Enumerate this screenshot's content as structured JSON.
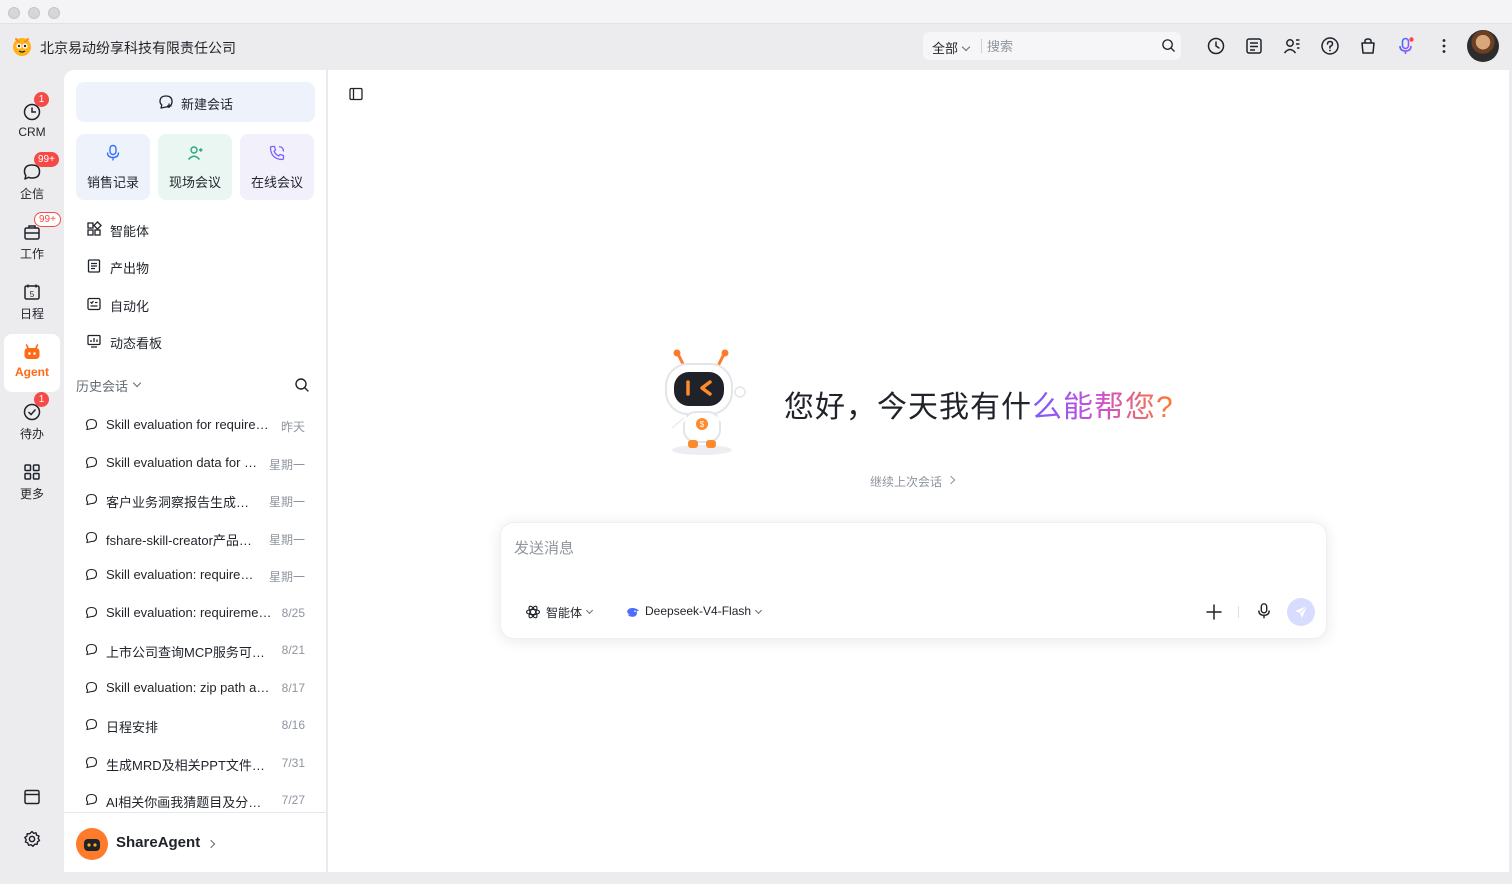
{
  "window": {
    "traffic_lights": [
      "close",
      "minimize",
      "zoom"
    ]
  },
  "header": {
    "company": "北京易动纷享科技有限责任公司",
    "search": {
      "scope": "全部",
      "placeholder": "搜索"
    },
    "icons": [
      "history-icon",
      "notes-icon",
      "contacts-icon",
      "help-icon",
      "shop-icon",
      "voice-assistant-icon",
      "more-icon"
    ]
  },
  "nav": {
    "items": [
      {
        "id": "crm",
        "label": "CRM",
        "badge": "1",
        "icon": "clock-icon"
      },
      {
        "id": "qixin",
        "label": "企信",
        "badge": "99+",
        "icon": "chat-bubble-icon"
      },
      {
        "id": "work",
        "label": "工作",
        "badge": "99+",
        "icon": "briefcase-icon"
      },
      {
        "id": "schedule",
        "label": "日程",
        "badge": "",
        "icon": "calendar-icon",
        "icon_text": "5"
      },
      {
        "id": "agent",
        "label": "Agent",
        "badge": "",
        "icon": "agent-icon",
        "active": true
      },
      {
        "id": "todo",
        "label": "待办",
        "badge": "1",
        "icon": "check-circle-icon"
      },
      {
        "id": "more",
        "label": "更多",
        "badge": "",
        "icon": "grid-icon"
      }
    ],
    "bottom_icons": [
      "window-icon",
      "settings-icon"
    ]
  },
  "sidebar": {
    "new_chat": "新建会话",
    "quick_actions": [
      {
        "label": "销售记录",
        "icon": "mic-icon",
        "bg": "#eef3fb"
      },
      {
        "label": "现场会议",
        "icon": "people-icon",
        "bg": "#eaf6f2"
      },
      {
        "label": "在线会议",
        "icon": "phone-icon",
        "bg": "#f2f0fb"
      }
    ],
    "menu": [
      {
        "label": "智能体",
        "icon": "apps-icon"
      },
      {
        "label": "产出物",
        "icon": "document-icon"
      },
      {
        "label": "自动化",
        "icon": "automation-icon"
      },
      {
        "label": "动态看板",
        "icon": "dashboard-icon"
      }
    ],
    "history_title": "历史会话",
    "history": [
      {
        "title": "Skill evaluation for require…",
        "date": "昨天"
      },
      {
        "title": "Skill evaluation data for …",
        "date": "星期一"
      },
      {
        "title": "客户业务洞察报告生成…",
        "date": "星期一"
      },
      {
        "title": "fshare-skill-creator产品…",
        "date": "星期一"
      },
      {
        "title": "Skill evaluation: require…",
        "date": "星期一"
      },
      {
        "title": "Skill evaluation: requireme…",
        "date": "8/25"
      },
      {
        "title": "上市公司查询MCP服务可…",
        "date": "8/21"
      },
      {
        "title": "Skill evaluation: zip path a…",
        "date": "8/17"
      },
      {
        "title": "日程安排",
        "date": "8/16"
      },
      {
        "title": "生成MRD及相关PPT文件…",
        "date": "7/31"
      },
      {
        "title": "AI相关你画我猜题目及分…",
        "date": "7/27"
      }
    ],
    "footer": {
      "name": "ShareAgent"
    }
  },
  "main": {
    "greeting_part1": "您好，今天我有什",
    "greeting_part2": "么能帮您?",
    "continue_label": "继续上次会话",
    "composer": {
      "placeholder": "发送消息",
      "agent_selector": "智能体",
      "model_selector": "Deepseek-V4-Flash"
    }
  },
  "colors": {
    "accent": "#ff6a16",
    "badge": "#f54a45",
    "brand_blue": "#3370ff",
    "send_bg": "#d8dcff"
  }
}
